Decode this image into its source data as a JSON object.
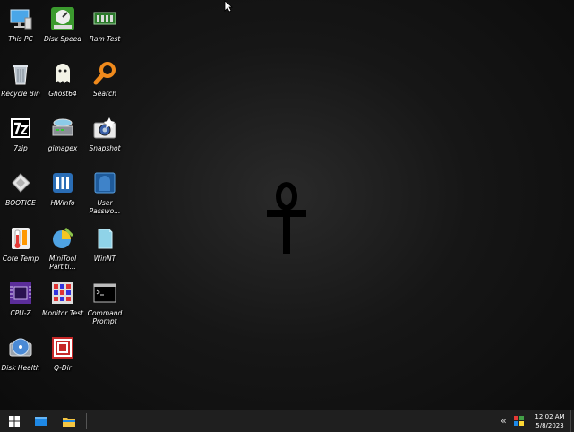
{
  "desktop": {
    "icons": [
      {
        "label": "This PC"
      },
      {
        "label": "Disk Speed"
      },
      {
        "label": "Ram Test"
      },
      {
        "label": "Recycle Bin"
      },
      {
        "label": "Ghost64"
      },
      {
        "label": "Search"
      },
      {
        "label": "7zip"
      },
      {
        "label": "gimagex"
      },
      {
        "label": "Snapshot"
      },
      {
        "label": "BOOTICE"
      },
      {
        "label": "HWinfo"
      },
      {
        "label": "User Passwo..."
      },
      {
        "label": "Core Temp"
      },
      {
        "label": "MiniTool Partiti..."
      },
      {
        "label": "WinNT"
      },
      {
        "label": "CPU-Z"
      },
      {
        "label": "Monitor Test"
      },
      {
        "label": "Command Prompt"
      },
      {
        "label": "Disk Health"
      },
      {
        "label": "Q-Dir"
      }
    ]
  },
  "taskbar": {
    "tray_chevron": "«",
    "clock_time": "12:02 AM",
    "clock_date": "5/8/2023"
  },
  "colors": {
    "accent": "#0a84ff",
    "taskbar": "#1f1f1f"
  }
}
